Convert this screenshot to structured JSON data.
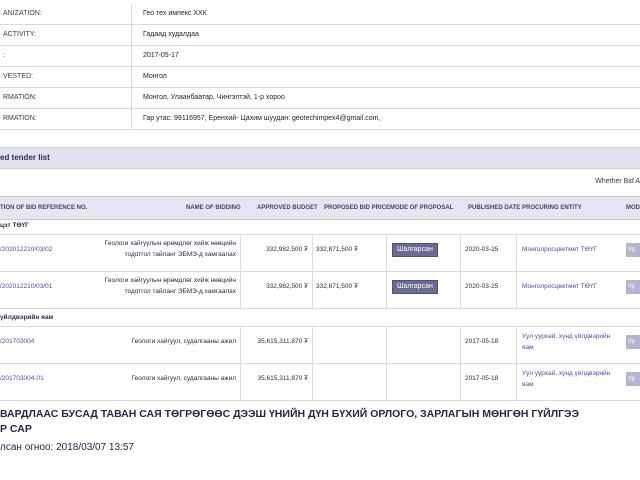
{
  "info": [
    {
      "label": "ANIZATION:",
      "value": "Гео тех импекс ХХК"
    },
    {
      "label": "ACTIVITY:",
      "value": "Гадаад худалдаа"
    },
    {
      "label": ":",
      "value": "2017-05-17"
    },
    {
      "label": "VESTED:",
      "value": "Монгол"
    },
    {
      "label": "RMATION:",
      "value": "Монгол, Улаанбаатар, Чингэлтэй, 1-р хороо"
    },
    {
      "label": "RMATION:",
      "value": "Гар утас: 99116957, Еренхий- Цахим шуудан: geotechimpex4@gmail.com,"
    }
  ],
  "section_title": "ed tender list",
  "filter_text": "Whether Bid A",
  "columns": {
    "ref": "TION OF BID REFERENCE NO.",
    "name": "NAME OF BIDDING",
    "budget": "APPROVED BUDGET",
    "price": "PROPOSED BID PRICE",
    "mode": "MODE OF PROPOSAL",
    "date": "PUBLISHED DATE",
    "entity": "PROCURING ENTITY",
    "edge": "MODI"
  },
  "groups": [
    {
      "title": "цэт ТӨҮГ",
      "rows": [
        {
          "ref": "/202012210/03/02",
          "name_1": "Геологи хайгуулын өрөмдлөг хийж нөөцийн",
          "name_2": "тодотгол тайланг ЭБМЭ-д хамгаалах",
          "budget": "332,982,500 ₮",
          "price": "332,871,500 ₮",
          "mode": "Шалгарсан",
          "date": "2020-03-25",
          "entity_1": "Монголросцветмет ТӨҮГ",
          "entity_2": "",
          "edge": "Ур"
        },
        {
          "ref": "/202012210/03/01",
          "name_1": "Геологи хайгуулын өрөмдлөг хийж нөөцийн",
          "name_2": "тодотгол тайланг ЭБМЭ-д хамгаалах",
          "budget": "332,982,500 ₮",
          "price": "332,871,500 ₮",
          "mode": "Шалгарсан",
          "date": "2020-03-25",
          "entity_1": "Монголросцветмет ТӨҮГ",
          "entity_2": "",
          "edge": "Ур"
        }
      ]
    },
    {
      "title": "үйлдвэрийн яам",
      "rows": [
        {
          "ref": "/201703004",
          "name_1": "Геологи хайгуул, судалгааны ажил",
          "name_2": "",
          "budget": "35,615,311,870 ₮",
          "price": "",
          "mode": "",
          "date": "2017-05-18",
          "entity_1": "Уул уурхай, хүнд үйлдвэрийн",
          "entity_2": "яам",
          "edge": "Ур"
        },
        {
          "ref": "/201703004-01",
          "name_1": "Геологи хайгуул, судалгааны ажил",
          "name_2": "",
          "budget": "35,615,311,870 ₮",
          "price": "",
          "mode": "",
          "date": "2017-05-18",
          "entity_1": "Уул уурхай, хүнд үйлдвэрийн",
          "entity_2": "яам",
          "edge": "Ур"
        }
      ]
    }
  ],
  "footer": {
    "line1": "ВАРДЛААС БУСАД ТАВАН САЯ ТӨГРӨГӨӨС ДЭЭШ ҮНИЙН ДҮН БҮХИЙ ОРЛОГО, ЗАРЛАГЫН МӨНГӨН ГҮЙЛГЭЭ",
    "line2": "Р САР",
    "line3": "лсан огноо: 2018/03/07 13:57"
  }
}
